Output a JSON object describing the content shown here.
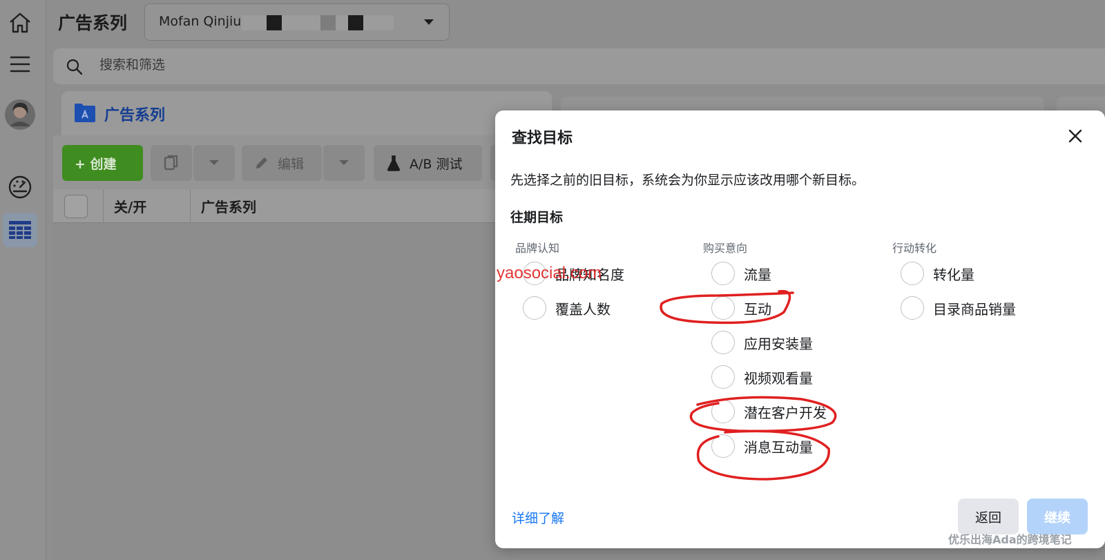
{
  "header": {
    "title": "广告系列",
    "account_name": "Mofan Qinjiu",
    "search_placeholder": "搜索和筛选"
  },
  "tabs": {
    "campaigns": "广告系列"
  },
  "toolbar": {
    "create": "+ 创建",
    "edit": "编辑",
    "ab_test": "A/B 测试"
  },
  "table": {
    "columns": [
      "关/开",
      "广告系列"
    ]
  },
  "modal": {
    "title": "查找目标",
    "description": "先选择之前的旧目标，系统会为你显示应该改用哪个新目标。",
    "section_label": "往期目标",
    "groups": [
      {
        "label": "品牌认知",
        "options": [
          "品牌知名度",
          "覆盖人数"
        ]
      },
      {
        "label": "购买意向",
        "options": [
          "流量",
          "互动",
          "应用安装量",
          "视频观看量",
          "潜在客户开发",
          "消息互动量"
        ]
      },
      {
        "label": "行动转化",
        "options": [
          "转化量",
          "目录商品销量"
        ]
      }
    ],
    "learn_more": "详细了解",
    "back": "返回",
    "continue": "继续",
    "watermark": "yaosocial.com"
  },
  "watermark_bottom": "优乐出海Ada的跨境笔记",
  "colors": {
    "accent": "#1877f2",
    "create_green": "#42b72a",
    "annotation_red": "#e02020"
  }
}
